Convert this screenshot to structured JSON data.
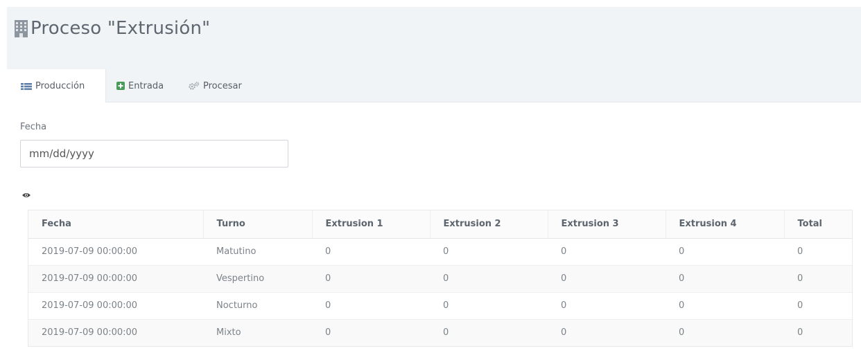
{
  "page": {
    "title": "Proceso \"Extrusión\""
  },
  "tabs": [
    {
      "label": "Producción",
      "icon": "list-icon",
      "active": true
    },
    {
      "label": "Entrada",
      "icon": "plus-square-icon",
      "active": false
    },
    {
      "label": "Procesar",
      "icon": "gears-icon",
      "active": false
    }
  ],
  "form": {
    "fecha_label": "Fecha",
    "fecha_placeholder": "mm/dd/yyyy"
  },
  "table": {
    "headers": [
      "Fecha",
      "Turno",
      "Extrusion 1",
      "Extrusion 2",
      "Extrusion 3",
      "Extrusion 4",
      "Total"
    ],
    "rows": [
      [
        "2019-07-09 00:00:00",
        "Matutino",
        "0",
        "0",
        "0",
        "0",
        "0"
      ],
      [
        "2019-07-09 00:00:00",
        "Vespertino",
        "0",
        "0",
        "0",
        "0",
        "0"
      ],
      [
        "2019-07-09 00:00:00",
        "Nocturno",
        "0",
        "0",
        "0",
        "0",
        "0"
      ],
      [
        "2019-07-09 00:00:00",
        "Mixto",
        "0",
        "0",
        "0",
        "0",
        "0"
      ]
    ]
  },
  "colors": {
    "header_band": "#f1f4f7",
    "title_text": "#5e6770",
    "icon_blue": "#5b7da8",
    "icon_green": "#4b9a5c"
  }
}
